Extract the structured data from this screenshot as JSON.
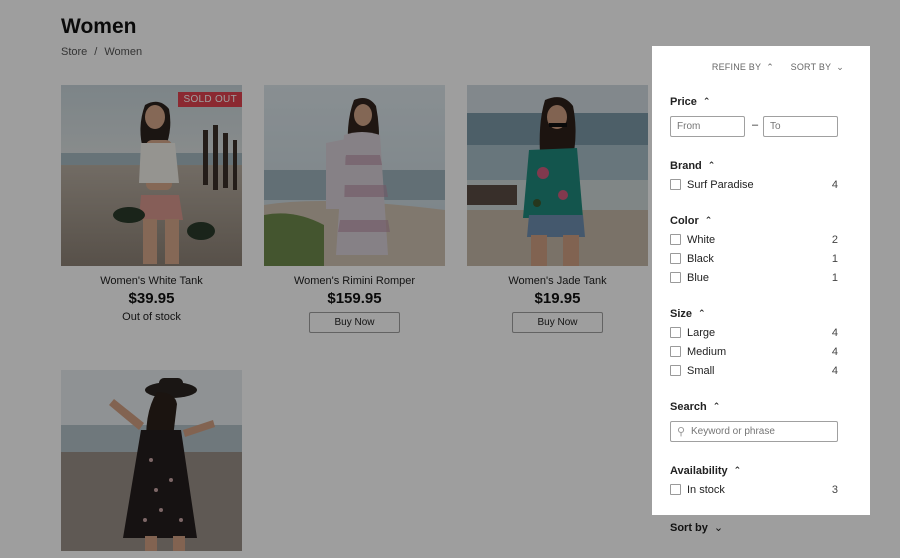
{
  "page": {
    "title": "Women",
    "breadcrumb": [
      "Store",
      "Women"
    ],
    "breadcrumb_sep": "/"
  },
  "products": [
    {
      "name": "Women's White Tank",
      "price": "$39.95",
      "badge": "SOLD OUT",
      "status": "Out of stock"
    },
    {
      "name": "Women's Rimini Romper",
      "price": "$159.95",
      "button": "Buy Now"
    },
    {
      "name": "Women's Jade Tank",
      "price": "$19.95",
      "button": "Buy Now"
    },
    {
      "name": ""
    }
  ],
  "panel": {
    "refine_label": "REFINE BY",
    "sort_label": "SORT BY",
    "price": {
      "heading": "Price",
      "from_placeholder": "From",
      "to_placeholder": "To",
      "dash": "–"
    },
    "brand": {
      "heading": "Brand",
      "options": [
        {
          "label": "Surf Paradise",
          "count": "4"
        }
      ]
    },
    "color": {
      "heading": "Color",
      "options": [
        {
          "label": "White",
          "count": "2"
        },
        {
          "label": "Black",
          "count": "1"
        },
        {
          "label": "Blue",
          "count": "1"
        }
      ]
    },
    "size": {
      "heading": "Size",
      "options": [
        {
          "label": "Large",
          "count": "4"
        },
        {
          "label": "Medium",
          "count": "4"
        },
        {
          "label": "Small",
          "count": "4"
        }
      ]
    },
    "search": {
      "heading": "Search",
      "placeholder": "Keyword or phrase"
    },
    "availability": {
      "heading": "Availability",
      "options": [
        {
          "label": "In stock",
          "count": "3"
        }
      ]
    },
    "sort_by_footer": "Sort by"
  },
  "icons": {
    "caret_up": "chevron-up-icon",
    "caret_down": "chevron-down-icon",
    "search": "search-icon"
  },
  "colors": {
    "badge": "#e0434f",
    "overlay": "rgba(0,0,0,0.38)"
  }
}
